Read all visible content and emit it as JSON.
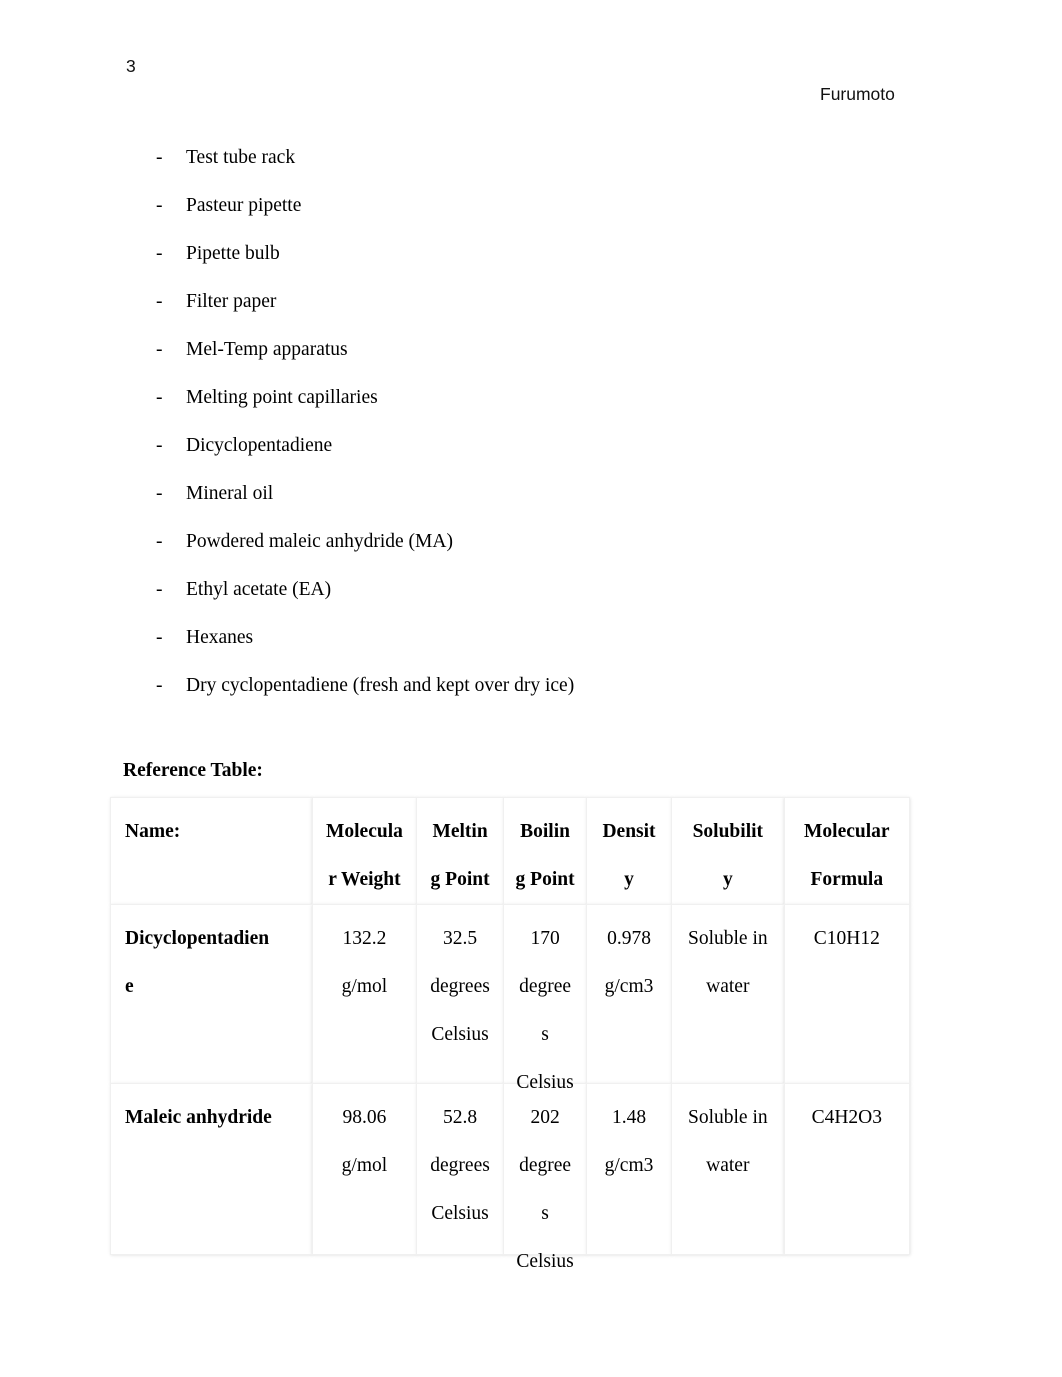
{
  "document": {
    "page_number": "3",
    "header_name": "Furumoto"
  },
  "materials": {
    "bullet": "-",
    "items": [
      "Test tube rack",
      "Pasteur pipette",
      "Pipette bulb",
      "Filter paper",
      "Mel-Temp apparatus",
      "Melting point capillaries",
      "Dicyclopentadiene",
      "Mineral oil",
      "Powdered maleic anhydride (MA)",
      "Ethyl acetate (EA)",
      "Hexanes",
      "Dry cyclopentadiene (fresh and kept over dry ice)"
    ]
  },
  "reference_table": {
    "heading": "Reference Table:",
    "headers": [
      {
        "line1": "Name:",
        "line2": ""
      },
      {
        "line1": "Molecula",
        "line2": "r Weight"
      },
      {
        "line1": "Meltin",
        "line2": "g Point"
      },
      {
        "line1": "Boilin",
        "line2": "g Point"
      },
      {
        "line1": "Densit",
        "line2": "y"
      },
      {
        "line1": "Solubilit",
        "line2": "y"
      },
      {
        "line1": "Molecular",
        "line2": "Formula"
      }
    ],
    "rows": [
      {
        "name_line1": "Dicyclopentadien",
        "name_line2": "e",
        "molecular_weight_line1": "132.2",
        "molecular_weight_line2": "g/mol",
        "melting_point_line1": "32.5",
        "melting_point_line2": "degrees",
        "melting_point_line3": "Celsius",
        "boiling_point_line1": "170",
        "boiling_point_line2": "degree",
        "boiling_point_line3": "s",
        "boiling_point_line4": "Celsius",
        "density_line1": "0.978",
        "density_line2": "g/cm3",
        "solubility_line1": "Soluble in",
        "solubility_line2": "water",
        "molecular_formula": "C10H12"
      },
      {
        "name_line1": "Maleic anhydride",
        "name_line2": "",
        "molecular_weight_line1": "98.06",
        "molecular_weight_line2": "g/mol",
        "melting_point_line1": "52.8",
        "melting_point_line2": "degrees",
        "melting_point_line3": "Celsius",
        "boiling_point_line1": "202",
        "boiling_point_line2": "degree",
        "boiling_point_line3": "s",
        "boiling_point_line4": "Celsius",
        "density_line1": "1.48",
        "density_line2": "g/cm3",
        "solubility_line1": "Soluble in",
        "solubility_line2": "water",
        "molecular_formula": "C4H2O3"
      }
    ]
  }
}
